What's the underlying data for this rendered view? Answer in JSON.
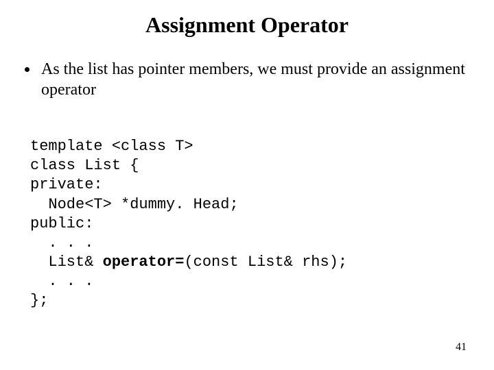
{
  "title": "Assignment Operator",
  "bullet": "As the list has pointer members, we must provide an assignment operator",
  "code": {
    "l1": "template <class T>",
    "l2": "class List {",
    "l3": "private:",
    "l4": "  Node<T> *dummy. Head;",
    "l5": "public:",
    "l6": "  . . .",
    "l7a": "  List& ",
    "l7b": "operator=",
    "l7c": "(const List& rhs);",
    "l8": "  . . .",
    "l9": "};"
  },
  "page_number": "41"
}
